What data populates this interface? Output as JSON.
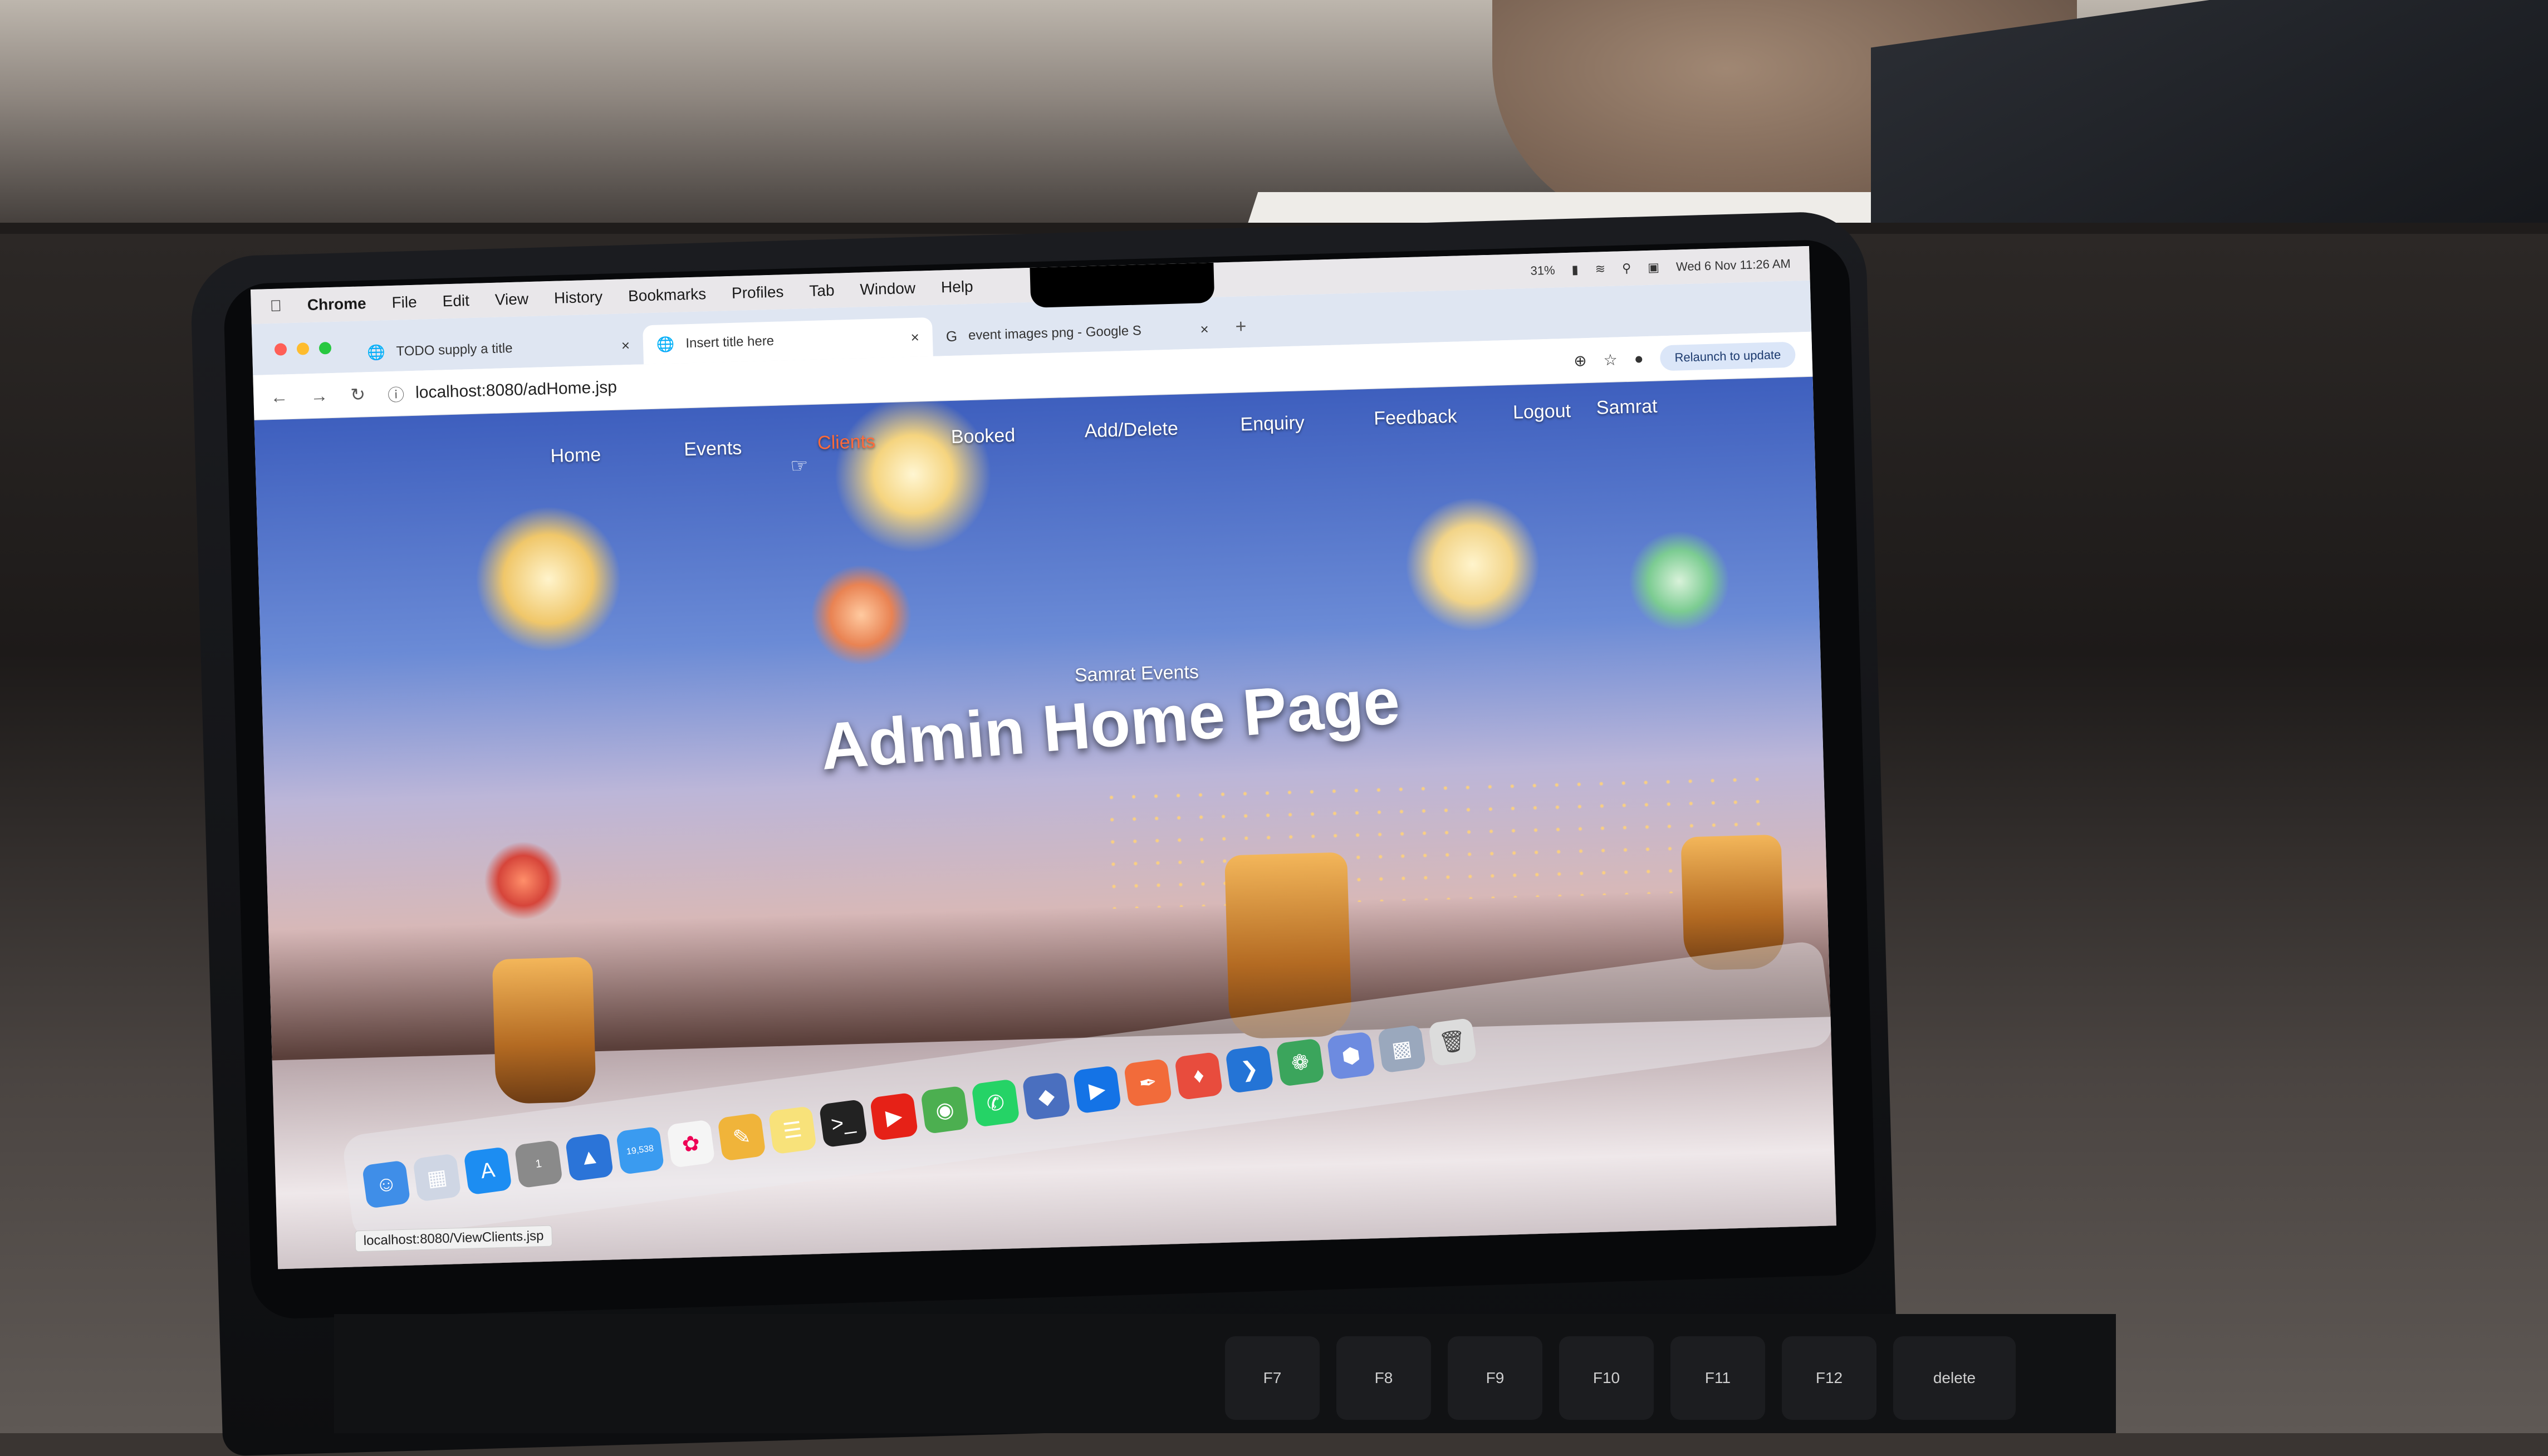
{
  "menubar": {
    "app_name": "Chrome",
    "items": [
      "File",
      "Edit",
      "View",
      "History",
      "Bookmarks",
      "Profiles",
      "Tab",
      "Window",
      "Help"
    ],
    "battery": "31%",
    "clock": "Wed 6 Nov  11:26 AM"
  },
  "tabs": [
    {
      "title": "TODO supply a title",
      "icon": "globe-icon"
    },
    {
      "title": "Insert title here",
      "icon": "globe-icon"
    },
    {
      "title": "event images png - Google S",
      "icon": "google-icon"
    }
  ],
  "toolbar": {
    "url": "localhost:8080/adHome.jsp",
    "relaunch_label": "Relaunch to update"
  },
  "site_nav": {
    "items": [
      "Home",
      "Events",
      "Clients",
      "Booked",
      "Add/Delete",
      "Enquiry",
      "Feedback",
      "Logout",
      "Samrat"
    ]
  },
  "hero": {
    "subtitle": "Samrat Events",
    "title": "Admin Home Page"
  },
  "status_bar": {
    "url": "localhost:8080/ViewClients.jsp"
  },
  "dock": {
    "badges": {
      "system_settings": "1",
      "mail": "19,538"
    }
  },
  "keyboard": {
    "keys": [
      "F7",
      "F8",
      "F9",
      "F10",
      "F11",
      "F12",
      "delete"
    ]
  },
  "colors": {
    "accent_hover": "#ff6a3a",
    "tab_bar": "#dfe6f2",
    "menubar": "#e9e7ea"
  }
}
